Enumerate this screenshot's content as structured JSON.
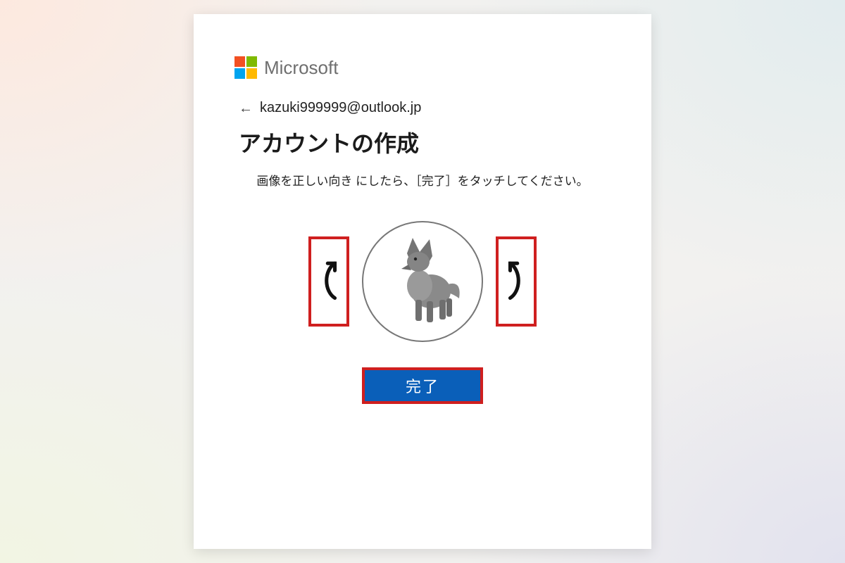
{
  "brand": {
    "name": "Microsoft"
  },
  "email": "kazuki999999@outlook.jp",
  "title": "アカウントの作成",
  "instruction": "画像を正しい向き にしたら、［完了］をタッチしてください。",
  "buttons": {
    "done": "完了"
  },
  "colors": {
    "accent": "#0a5fb9",
    "highlight_border": "#cf1f1f"
  },
  "captcha": {
    "image_subject": "fox"
  },
  "icons": {
    "back": "arrow-left-icon",
    "rotate_cw": "rotate-clockwise-icon",
    "rotate_ccw": "rotate-counterclockwise-icon",
    "refresh": "refresh-icon",
    "audio": "audio-captcha-icon"
  }
}
